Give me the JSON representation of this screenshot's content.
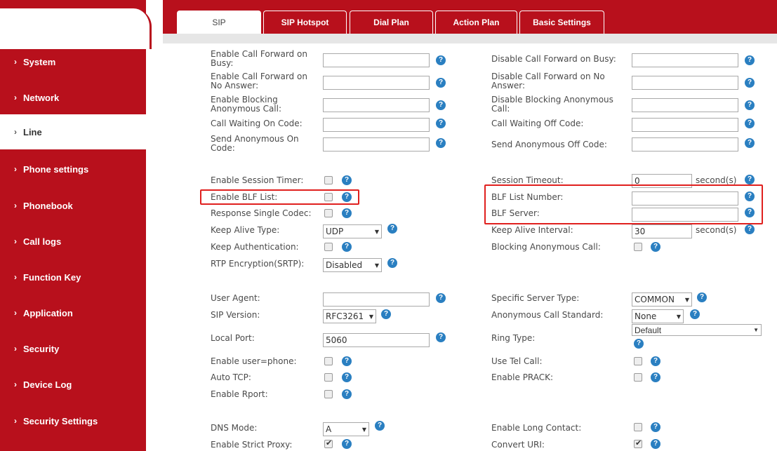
{
  "sidebar": {
    "items": [
      {
        "label": "System"
      },
      {
        "label": "Network"
      },
      {
        "label": "Line"
      },
      {
        "label": "Phone settings"
      },
      {
        "label": "Phonebook"
      },
      {
        "label": "Call logs"
      },
      {
        "label": "Function Key"
      },
      {
        "label": "Application"
      },
      {
        "label": "Security"
      },
      {
        "label": "Device Log"
      },
      {
        "label": "Security Settings"
      }
    ]
  },
  "tabs": [
    {
      "label": "SIP"
    },
    {
      "label": "SIP Hotspot"
    },
    {
      "label": "Dial Plan"
    },
    {
      "label": "Action Plan"
    },
    {
      "label": "Basic Settings"
    }
  ],
  "help_glyph": "?",
  "form": {
    "left": {
      "enable_cf_busy": "Enable Call Forward on\nBusy:",
      "enable_cf_no_answer": "Enable Call Forward on\nNo Answer:",
      "enable_blocking_anon": "Enable Blocking\nAnonymous Call:",
      "call_waiting_on": "Call Waiting On Code:",
      "send_anon_on": "Send Anonymous On\nCode:",
      "session_timer": "Enable Session Timer:",
      "blf_list": "Enable BLF List:",
      "single_codec": "Response Single Codec:",
      "keep_alive_type": "Keep Alive Type:",
      "keep_alive_type_value": "UDP",
      "keep_auth": "Keep Authentication:",
      "rtp_encryption": "RTP Encryption(SRTP):",
      "rtp_encryption_value": "Disabled",
      "user_agent": "User Agent:",
      "sip_version": "SIP Version:",
      "sip_version_value": "RFC3261",
      "local_port": "Local Port:",
      "local_port_value": "5060",
      "user_phone": "Enable user=phone:",
      "auto_tcp": "Auto TCP:",
      "rport": "Enable Rport:",
      "dns_mode": "DNS Mode:",
      "dns_mode_value": "A",
      "strict_proxy": "Enable Strict Proxy:"
    },
    "right": {
      "disable_cf_busy": "Disable Call Forward on Busy:",
      "disable_cf_no_answer": "Disable Call Forward on No\nAnswer:",
      "disable_blocking_anon": "Disable Blocking Anonymous\nCall:",
      "call_waiting_off": "Call Waiting Off Code:",
      "send_anon_off": "Send Anonymous Off Code:",
      "session_timeout": "Session Timeout:",
      "session_timeout_value": "0",
      "unit": "second(s)",
      "blf_list_number": "BLF List Number:",
      "blf_server": "BLF Server:",
      "keep_alive_interval": "Keep Alive Interval:",
      "keep_alive_interval_value": "30",
      "blocking_anon_call": "Blocking Anonymous Call:",
      "server_type": "Specific Server Type:",
      "server_type_value": "COMMON",
      "anon_standard": "Anonymous Call Standard:",
      "anon_standard_value": "None",
      "ring_type": "Ring Type:",
      "ring_type_value": "Default",
      "tel_call": "Use Tel Call:",
      "prack": "Enable PRACK:",
      "long_contact": "Enable Long Contact:",
      "convert_uri": "Convert URI:"
    }
  },
  "colors": {
    "brand": "#b8101c",
    "help": "#2a7fc1",
    "highlight": "#e0201e"
  },
  "icons": {
    "help": "help-icon",
    "chevron": "chevron-right-icon",
    "dropdown": "dropdown-arrow-icon"
  }
}
